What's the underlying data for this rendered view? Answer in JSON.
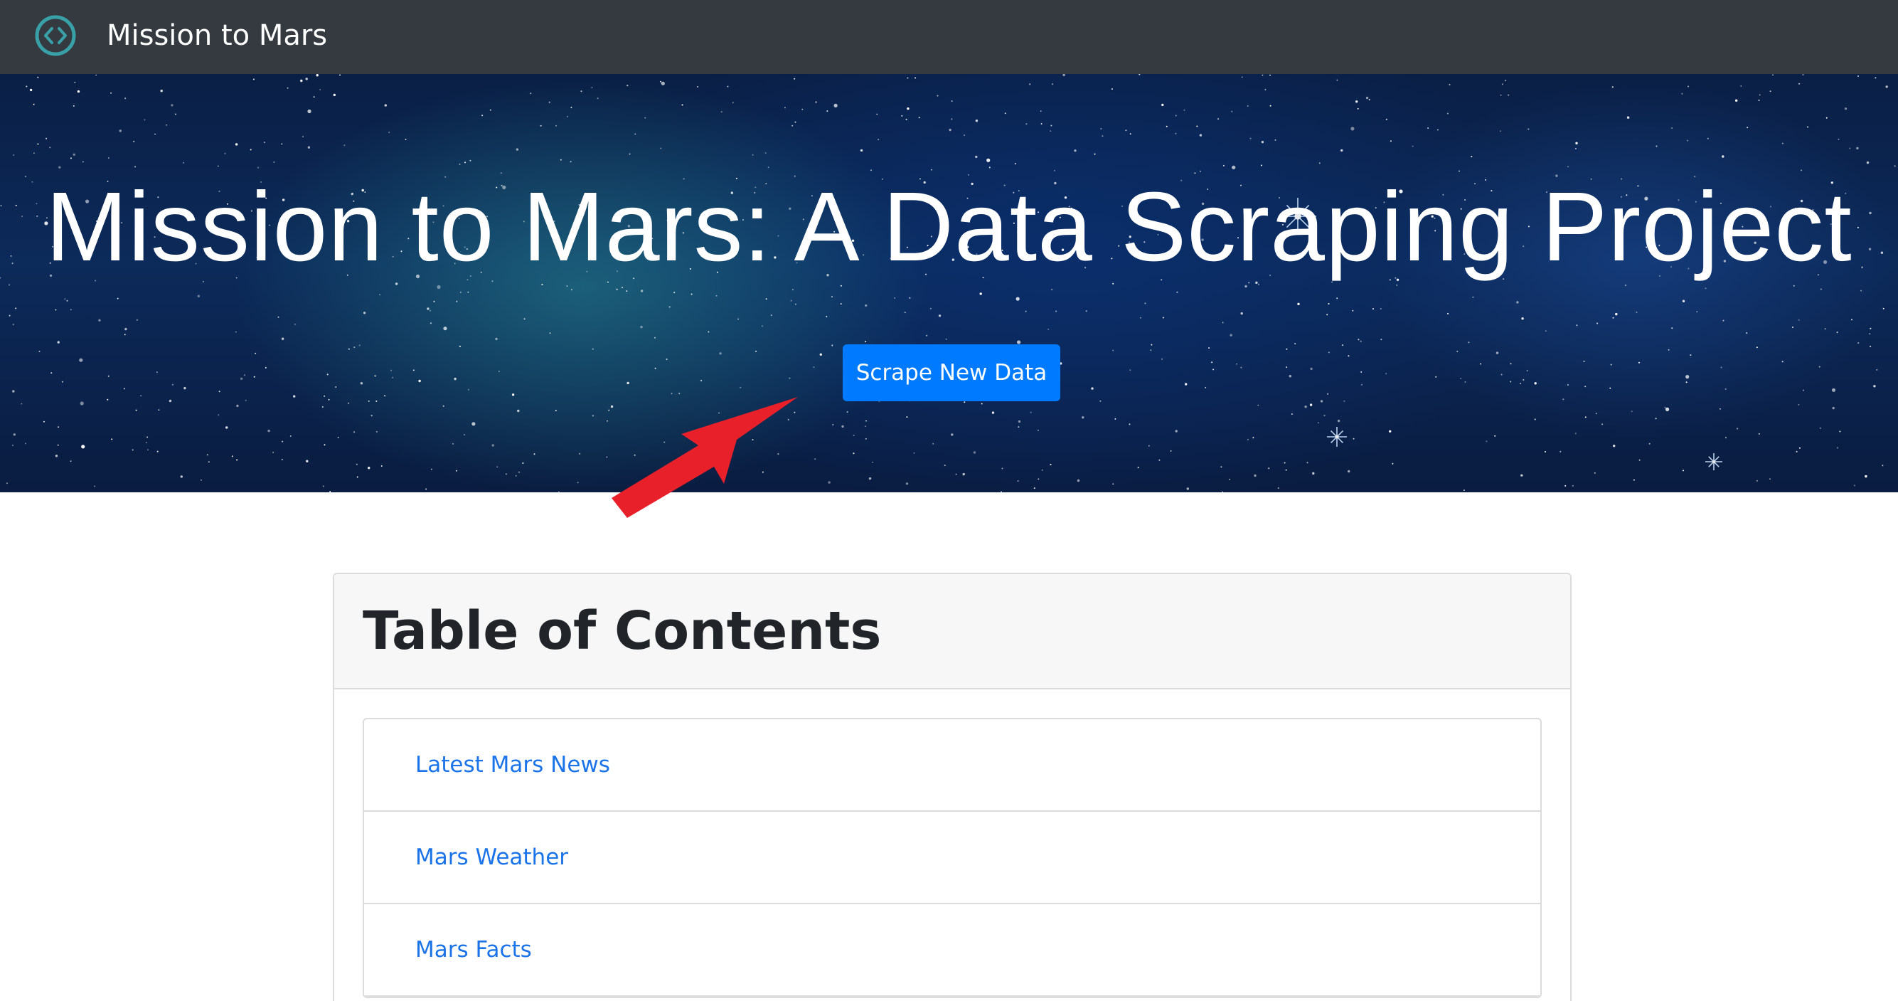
{
  "navbar": {
    "brand_icon": "code-circle-icon",
    "title": "Mission to Mars"
  },
  "hero": {
    "title": "Mission to Mars: A Data Scraping Project",
    "scrape_button_label": "Scrape New Data",
    "annotation": "red-arrow-icon"
  },
  "toc": {
    "heading": "Table of Contents",
    "items": [
      {
        "label": "Latest Mars News"
      },
      {
        "label": "Mars Weather"
      },
      {
        "label": "Mars Facts"
      }
    ]
  },
  "colors": {
    "navbar_bg": "#343a40",
    "primary": "#007bff",
    "link": "#1a73e8",
    "arrow": "#e8202a"
  }
}
